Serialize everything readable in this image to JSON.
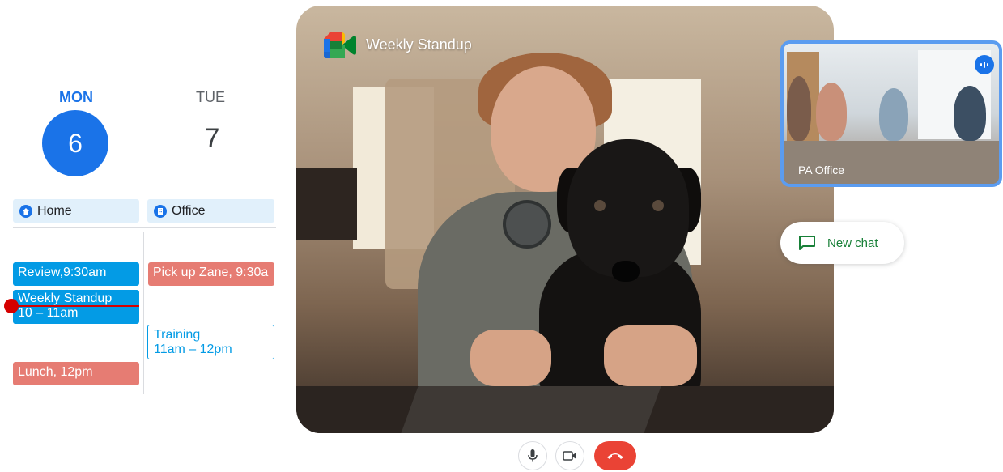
{
  "calendar": {
    "days": [
      {
        "name": "MON",
        "number": "6",
        "today": true
      },
      {
        "name": "TUE",
        "number": "7",
        "today": false
      }
    ],
    "locations": {
      "home": {
        "label": "Home",
        "icon": "home-icon"
      },
      "office": {
        "label": "Office",
        "icon": "building-icon"
      }
    },
    "events": {
      "review": {
        "title": "Review,",
        "time": "9:30am"
      },
      "standup": {
        "title": "Weekly Standup",
        "time": "10 – 11am"
      },
      "pickup": {
        "title": "Pick up Zane,",
        "time": "9:30a"
      },
      "training": {
        "title": "Training",
        "time": "11am – 12pm"
      },
      "lunch": {
        "title": "Lunch,",
        "time": "12pm"
      }
    },
    "colors": {
      "accent": "#1a73e8",
      "event_blue": "#039be5",
      "event_red": "#e67c73",
      "now_line": "#d50000"
    }
  },
  "meeting": {
    "title": "Weekly Standup",
    "logo_icon": "google-meet-icon",
    "pip": {
      "label": "PA Office",
      "speaking_icon": "speaking-indicator-icon"
    },
    "chat": {
      "label": "New chat",
      "icon": "chat-icon"
    },
    "controls": {
      "mic_icon": "microphone-icon",
      "camera_icon": "camera-icon",
      "end_icon": "end-call-icon"
    }
  }
}
